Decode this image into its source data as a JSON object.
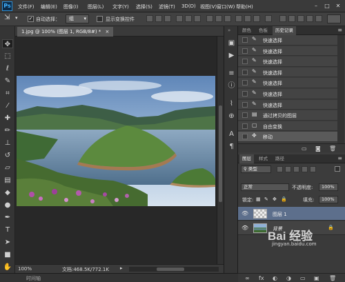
{
  "app": {
    "logo": "Ps"
  },
  "menu": [
    "文件(F)",
    "编辑(E)",
    "图像(I)",
    "图层(L)",
    "文字(Y)",
    "选择(S)",
    "滤镜(T)",
    "3D(D)",
    "视图(V)",
    "窗口(W)",
    "帮助(H)"
  ],
  "window_controls": {
    "minimize": "–",
    "restore": "□",
    "close": "✕"
  },
  "options": {
    "auto_select_label": "自动选择：",
    "auto_select_checked": true,
    "auto_select_value": "组",
    "show_transform_label": "显示变换控件",
    "show_transform_checked": false
  },
  "document": {
    "tab_title": "1.jpg @ 100% (图层 1, RGB/8#) *",
    "zoom": "100%",
    "doc_info": "文档:468.5K/772.1K"
  },
  "timeline_label": "时间轴",
  "tools": [
    "move-tool",
    "marquee-tool",
    "lasso-tool",
    "quick-select-tool",
    "crop-tool",
    "eyedropper-tool",
    "healing-tool",
    "brush-tool",
    "stamp-tool",
    "history-brush-tool",
    "eraser-tool",
    "gradient-tool",
    "blur-tool",
    "dodge-tool",
    "pen-tool",
    "type-tool",
    "path-select-tool",
    "shape-tool",
    "hand-tool",
    "zoom-tool"
  ],
  "panels_top": {
    "tabs": [
      "颜色",
      "色板",
      "历史记录"
    ],
    "active": "历史记录"
  },
  "history": [
    {
      "label": "快速选择",
      "icon": "brush-icon"
    },
    {
      "label": "快速选择",
      "icon": "brush-icon"
    },
    {
      "label": "快速选择",
      "icon": "brush-icon"
    },
    {
      "label": "快速选择",
      "icon": "brush-icon"
    },
    {
      "label": "快速选择",
      "icon": "brush-icon"
    },
    {
      "label": "快速选择",
      "icon": "brush-icon"
    },
    {
      "label": "快速选择",
      "icon": "brush-icon"
    },
    {
      "label": "通过拷贝的图层",
      "icon": "layer-icon"
    },
    {
      "label": "自由变换",
      "icon": "transform-icon"
    },
    {
      "label": "移动",
      "icon": "move-icon"
    }
  ],
  "panels_bottom": {
    "tabs": [
      "图层",
      "样式",
      "路径"
    ],
    "active": "图层"
  },
  "layers_panel": {
    "filter_label": "类型",
    "blend_mode": "正常",
    "opacity_label": "不透明度:",
    "opacity_value": "100%",
    "lock_label": "锁定:",
    "fill_label": "填充:",
    "fill_value": "100%",
    "layers": [
      {
        "name": "图层 1",
        "selected": true,
        "locked": false
      },
      {
        "name": "背景",
        "selected": false,
        "locked": true
      }
    ]
  },
  "watermark": {
    "brand": "Bai 经验",
    "url": "jingyan.baidu.com"
  },
  "colors": {
    "accent": "#41b2ff",
    "panel": "#3c3c3c",
    "selected": "#5a5a5a"
  }
}
